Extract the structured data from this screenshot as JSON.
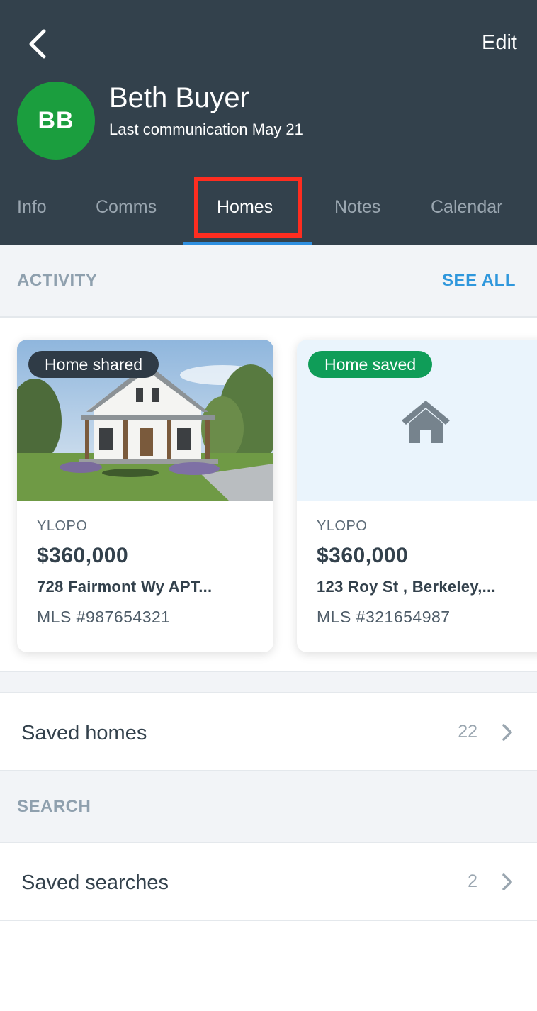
{
  "header": {
    "edit_label": "Edit",
    "avatar_initials": "BB",
    "name": "Beth Buyer",
    "last_communication": "Last communication May 21"
  },
  "tabs": [
    {
      "label": "Info",
      "active": false
    },
    {
      "label": "Comms",
      "active": false
    },
    {
      "label": "Homes",
      "active": true
    },
    {
      "label": "Notes",
      "active": false
    },
    {
      "label": "Calendar",
      "active": false
    }
  ],
  "activity": {
    "section_label": "ACTIVITY",
    "see_all_label": "SEE ALL",
    "cards": [
      {
        "badge": "Home shared",
        "badge_color": "#2f3b46",
        "source": "YLOPO",
        "price": "$360,000",
        "address": "728 Fairmont Wy APT...",
        "mls": "MLS #987654321",
        "image": "house-photo"
      },
      {
        "badge": "Home saved",
        "badge_color": "#0f9d58",
        "source": "YLOPO",
        "price": "$360,000",
        "address": "123 Roy St , Berkeley,...",
        "mls": "MLS #321654987",
        "image": "home-icon"
      }
    ]
  },
  "saved_homes": {
    "label": "Saved homes",
    "count": "22"
  },
  "search": {
    "section_label": "SEARCH",
    "saved_searches": {
      "label": "Saved searches",
      "count": "2"
    }
  },
  "colors": {
    "header_bg": "#33414c",
    "avatar_bg": "#1b9e3e",
    "accent": "#2f97dc",
    "highlight": "#ff2d20"
  }
}
